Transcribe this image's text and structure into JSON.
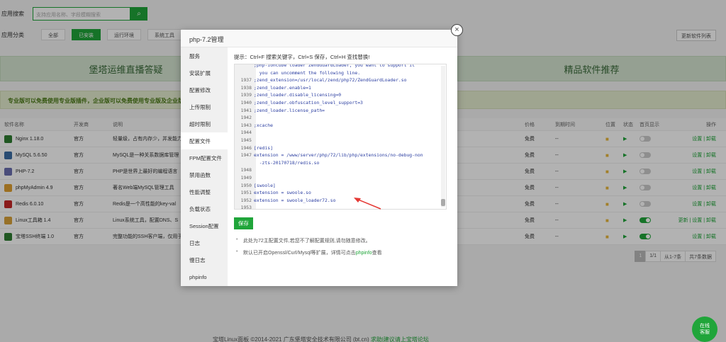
{
  "top": {
    "search_label": "应用搜索",
    "search_placeholder": "支持应用名称、字段模糊搜索",
    "category_label": "应用分类",
    "categories": [
      "全部",
      "已安装",
      "运行环境",
      "系统工具"
    ],
    "update_button": "更新软件列表"
  },
  "banners": {
    "left": "堡塔运维直播答疑",
    "right": "精品软件推荐"
  },
  "notice": "专业版可以免费使用专业版插件，企业版可以免费使用专业版及企业版插件",
  "table": {
    "headers": {
      "name": "软件名称",
      "dev": "开发商",
      "desc": "说明",
      "price": "价格",
      "expire": "到期时间",
      "location": "位置",
      "status": "状态",
      "home": "首页显示",
      "op": "操作"
    },
    "rows": [
      {
        "name": "Nginx 1.18.0",
        "dev": "官方",
        "desc": "轻量级，占有内存少，并发能力",
        "price": "免费",
        "expire": "--",
        "home_on": false,
        "ops": "设置 | 卸载",
        "color": "#2e7d32"
      },
      {
        "name": "MySQL 5.6.50",
        "dev": "官方",
        "desc": "MySQL是一种关系数据库管理",
        "price": "免费",
        "expire": "--",
        "home_on": false,
        "ops": "设置 | 卸载",
        "color": "#3b6ea5"
      },
      {
        "name": "PHP-7.2",
        "dev": "官方",
        "desc": "PHP是世界上最好的编程语言",
        "price": "免费",
        "expire": "--",
        "home_on": false,
        "ops": "设置 | 卸载",
        "color": "#6a6fb0"
      },
      {
        "name": "phpMyAdmin 4.9",
        "dev": "官方",
        "desc": "著名Web端MySQL管理工具",
        "price": "免费",
        "expire": "--",
        "home_on": false,
        "ops": "设置 | 卸载",
        "color": "#e0a030"
      },
      {
        "name": "Redis 6.0.10",
        "dev": "官方",
        "desc": "Redis是一个高性能的key-val",
        "price": "免费",
        "expire": "--",
        "home_on": false,
        "ops": "设置 | 卸载",
        "color": "#c62828"
      },
      {
        "name": "Linux工具箱 1.4",
        "dev": "官方",
        "desc": "Linux系统工具，配置DNS、S",
        "price": "免费",
        "expire": "--",
        "home_on": true,
        "ops": "更新 | 设置 | 卸载",
        "color": "#d9a23a"
      },
      {
        "name": "宝塔SSH终端 1.0",
        "dev": "官方",
        "desc": "完整功能的SSH客户端，仅用于",
        "price": "免费",
        "expire": "--",
        "home_on": true,
        "ops": "设置 | 卸载",
        "color": "#2e7d32"
      }
    ]
  },
  "pager": {
    "current": "1",
    "total_pages": "1/1",
    "range": "从1-7条",
    "count": "共7条数据"
  },
  "footer": {
    "text": "宝塔Linux面板 ©2014-2021 广东堡塔安全技术有限公司 (bt.cn)",
    "link": "求助|建议请上宝塔论坛"
  },
  "chat": {
    "line1": "在线",
    "line2": "客服"
  },
  "modal": {
    "title": "php-7.2管理",
    "close": "×",
    "side_items": [
      "服务",
      "安装扩展",
      "配置修改",
      "上传限制",
      "超时限制",
      "配置文件",
      "FPM配置文件",
      "禁用函数",
      "性能调整",
      "负载状态",
      "Session配置",
      "日志",
      "慢日志",
      "phpinfo"
    ],
    "active_index": 5,
    "tip": "提示：Ctrl+F 搜索关键字，Ctrl+S 保存，Ctrl+H 查找替换!",
    "code_lines": [
      {
        "n": "",
        "t": ";php-ioncube loader ZendGuardLoader, you want to support it"
      },
      {
        "n": "",
        "t": "  you can uncomment the following line."
      },
      {
        "n": "1937",
        "t": ";zend_extension=/usr/local/zend/php72/ZendGuardLoader.so"
      },
      {
        "n": "1938",
        "t": ";zend_loader.enable=1"
      },
      {
        "n": "1939",
        "t": ";zend_loader.disable_licensing=0"
      },
      {
        "n": "1940",
        "t": ";zend_loader.obfuscation_level_support=3"
      },
      {
        "n": "1941",
        "t": ";zend_loader.license_path="
      },
      {
        "n": "1942",
        "t": ""
      },
      {
        "n": "1943",
        "t": ";xcache"
      },
      {
        "n": "1944",
        "t": ""
      },
      {
        "n": "1945",
        "t": ""
      },
      {
        "n": "1946",
        "t": "[redis]"
      },
      {
        "n": "1947",
        "t": "extension = /www/server/php/72/lib/php/extensions/no-debug-non"
      },
      {
        "n": "",
        "t": "  -zts-20170718/redis.so"
      },
      {
        "n": "1948",
        "t": ""
      },
      {
        "n": "1949",
        "t": ""
      },
      {
        "n": "1950",
        "t": "[swoole]"
      },
      {
        "n": "1951",
        "t": "extension = swoole.so"
      },
      {
        "n": "1952",
        "t": "extension = swoole_loader72.so"
      },
      {
        "n": "1953",
        "t": ""
      }
    ],
    "save": "保存",
    "note1": "此处为72主配置文件,若您不了解配置规则,请勿随意修改。",
    "note2_prefix": "默认已开启Openssl/Curl/Mysql等扩展，详情可点击",
    "note2_link": "phpinfo",
    "note2_suffix": "查看"
  }
}
